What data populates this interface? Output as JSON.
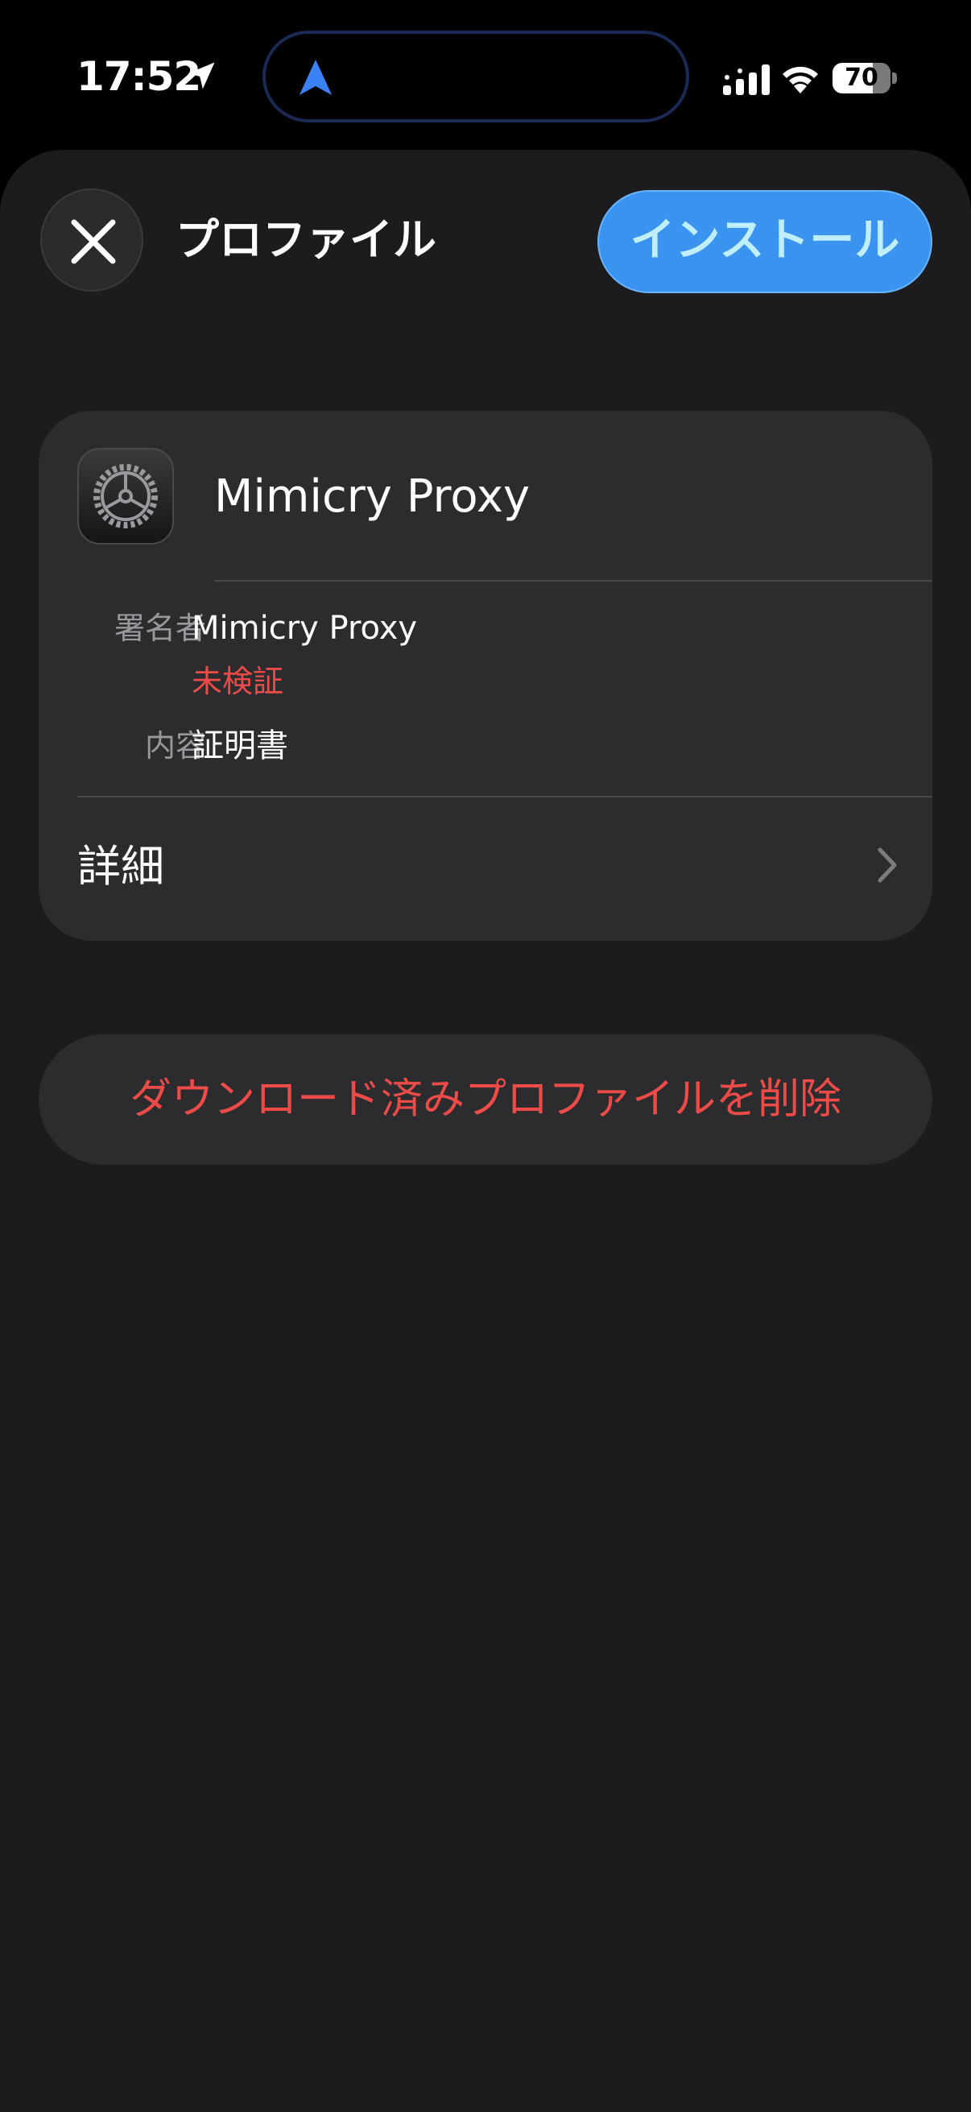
{
  "status_bar": {
    "time": "17:52",
    "battery": "70"
  },
  "header": {
    "title": "プロファイル",
    "install_label": "インストール"
  },
  "profile": {
    "name": "Mimicry Proxy",
    "signer_label": "署名者",
    "signer_value": "Mimicry Proxy",
    "verification_status": "未検証",
    "contents_label": "内容",
    "contents_value": "証明書",
    "details_label": "詳細"
  },
  "actions": {
    "delete_label": "ダウンロード済みプロファイルを削除"
  },
  "colors": {
    "accent": "#3a93ee",
    "destructive": "#ec4b48",
    "background": "#1c1c1e",
    "card": "#2c2c2e"
  }
}
